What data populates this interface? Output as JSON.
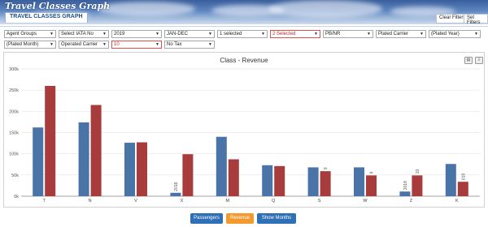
{
  "app": {
    "title": "Travel Classes Graph"
  },
  "header": {
    "tab_title": "TRAVEL CLASSES GRAPH",
    "clear_filters": "Clear Filters",
    "set_filters": "Set Filters"
  },
  "filters": {
    "row1": [
      {
        "label": "Agent Groups",
        "highlight": false
      },
      {
        "label": "Select IATA No",
        "highlight": false
      },
      {
        "label": "2019",
        "highlight": false
      },
      {
        "label": "JAN-DEC",
        "highlight": false
      },
      {
        "label": "1 selected",
        "highlight": false
      },
      {
        "label": "2 Selected",
        "highlight": true
      },
      {
        "label": "PB/NR",
        "highlight": false
      },
      {
        "label": "Plated Carrier",
        "highlight": false
      },
      {
        "label": "(Plated Year)",
        "highlight": false
      }
    ],
    "row2": [
      {
        "label": "(Plated Month)",
        "highlight": false
      },
      {
        "label": "Operated Carrier",
        "highlight": false
      },
      {
        "label": "10",
        "highlight": true
      },
      {
        "label": "No Tax",
        "highlight": false
      }
    ]
  },
  "chart_data": {
    "type": "bar",
    "title": "Class - Revenue",
    "categories": [
      "T",
      "N",
      "V",
      "X",
      "M",
      "Q",
      "S",
      "W",
      "Z",
      "K"
    ],
    "ylim": [
      0,
      300000
    ],
    "yticks": [
      "0k",
      "50k",
      "100k",
      "150k",
      "200k",
      "250k",
      "300k"
    ],
    "series": [
      {
        "name": "2018",
        "color": "#4a74a8",
        "values": [
          162000,
          174000,
          126000,
          8000,
          140000,
          73000,
          68000,
          68000,
          11000,
          76000
        ]
      },
      {
        "name": "2019",
        "color": "#a83c3c",
        "values": [
          260000,
          215000,
          127000,
          99000,
          87000,
          71000,
          59000,
          49000,
          49000,
          34000
        ]
      }
    ],
    "bar_labels": [
      {
        "category": "X",
        "series": "2018",
        "text": "2018"
      },
      {
        "category": "S",
        "series": "2019",
        "text": "9"
      },
      {
        "category": "W",
        "series": "2019",
        "text": "9"
      },
      {
        "category": "Z",
        "series": "2018",
        "text": "2018"
      },
      {
        "category": "Z",
        "series": "2019",
        "text": "19"
      },
      {
        "category": "K",
        "series": "2019",
        "text": "019"
      }
    ]
  },
  "bottom": {
    "passengers": "Passengers",
    "revenue": "Revenue",
    "show_months": "Show Months"
  }
}
